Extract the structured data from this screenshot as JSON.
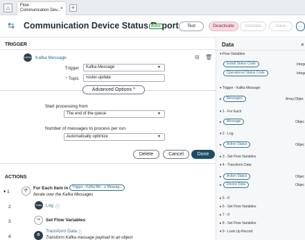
{
  "tabbar": {
    "tab_line1": "Flow",
    "tab_line2": "Communication Dev...",
    "close": "×",
    "add": "+"
  },
  "header": {
    "title": "Communication Device Status Report",
    "badge": "Active",
    "test": "Test",
    "deactivate": "Deactivate",
    "activate": "Activate",
    "save": "Save",
    "more": "..."
  },
  "trigger": {
    "section": "TRIGGER",
    "name": "Kafka Message",
    "trigger_label": "Trigger",
    "trigger_value": "Kafka Message",
    "topic_label": "Topic",
    "topic_value": "router-update",
    "advanced": "Advanced Options ^",
    "start_label": "Start processing from",
    "start_value": "The end of the queue",
    "num_label": "Number of messages to process per run",
    "num_value": "Automatically optimize",
    "delete": "Delete",
    "cancel": "Cancel",
    "done": "Done"
  },
  "actions": {
    "section": "ACTIONS",
    "rows": [
      {
        "num": "1",
        "title": "For Each Item in",
        "chip": "Trigger - Kafka Me... ▸ Messag...",
        "sub": "Iterate over the Kafka Messages"
      },
      {
        "num": "2",
        "title": "Log",
        "sub": ""
      },
      {
        "num": "3",
        "title": "Set Flow Variables",
        "sub": ""
      },
      {
        "num": "4",
        "title": "Transform Data",
        "sub": "Transform Kafka message payload to an object"
      }
    ]
  },
  "data_panel": {
    "title": "Data",
    "close": "×",
    "groups": [
      {
        "label": "Flow Variables",
        "chips": [
          {
            "label": "Install Status Code",
            "type": "Intege"
          },
          {
            "label": "Operational Status Code",
            "type": "Intege"
          }
        ]
      },
      {
        "label": "Trigger - Kafka Message",
        "chips": [
          {
            "label": "Messages",
            "type": "Array.Objec"
          }
        ]
      },
      {
        "label": "1 - For Each",
        "chips": [
          {
            "label": "Message",
            "type": "Objec"
          }
        ]
      },
      {
        "label": "2 - Log",
        "chips": [
          {
            "label": "Action Status",
            "type": "Objec"
          }
        ]
      },
      {
        "label": "3 - Set Flow Variables",
        "chips": []
      },
      {
        "label": "4 - Transform Data",
        "chips": [
          {
            "label": "Action Status",
            "type": "Objec"
          },
          {
            "label": "Device Data",
            "type": "Objec"
          }
        ]
      },
      {
        "label": "5 - If",
        "chips": []
      },
      {
        "label": "6 - Set Flow Variables",
        "chips": []
      },
      {
        "label": "7 - If",
        "chips": []
      },
      {
        "label": "8 - Set Flow Variables",
        "chips": []
      },
      {
        "label": "9 - Look Up Record",
        "chips": []
      }
    ]
  }
}
